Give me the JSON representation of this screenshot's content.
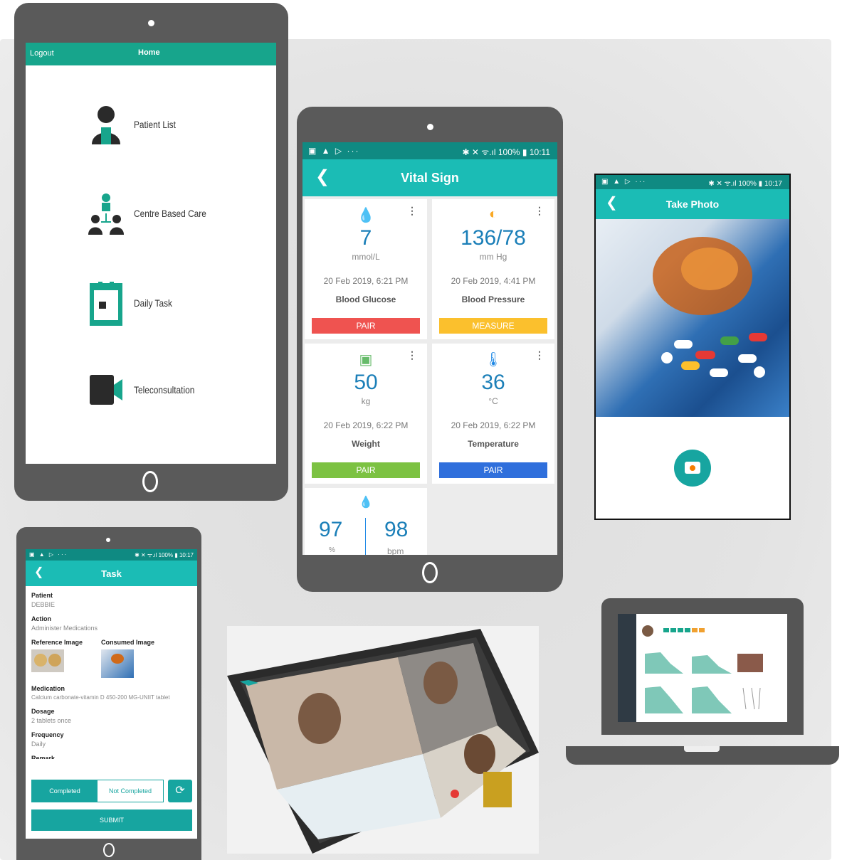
{
  "home": {
    "header": {
      "logout": "Logout",
      "title": "Home"
    },
    "items": [
      {
        "label": "Patient List",
        "icon": "patient-list-icon"
      },
      {
        "label": "Centre Based Care",
        "icon": "centre-care-icon"
      },
      {
        "label": "Daily Task",
        "icon": "daily-task-icon"
      },
      {
        "label": "Teleconsultation",
        "icon": "video-camera-icon"
      }
    ],
    "accent": "#17a58c"
  },
  "vital": {
    "status_left": "▣ ▲ ▷ ···",
    "status_right": "✱ ✕ ᯤ.ıl 100% ▮ 10:11",
    "title": "Vital Sign",
    "cards": [
      {
        "value": "7",
        "unit": "mmol/L",
        "date": "20 Feb 2019, 6:21 PM",
        "name": "Blood Glucose",
        "button": "PAIR",
        "btn_color": "#ef5350",
        "icon": "blood-drop-icon",
        "glyph": "💧",
        "icon_color": "#e53935"
      },
      {
        "value": "136/78",
        "unit": "mm Hg",
        "date": "20 Feb 2019, 4:41 PM",
        "name": "Blood Pressure",
        "button": "MEASURE",
        "btn_color": "#fbc02d",
        "icon": "bp-cuff-icon",
        "glyph": "◐",
        "icon_color": "#f9a825"
      },
      {
        "value": "50",
        "unit": "kg",
        "date": "20 Feb 2019, 6:22 PM",
        "name": "Weight",
        "button": "PAIR",
        "btn_color": "#7cc242",
        "icon": "scale-icon",
        "glyph": "▣",
        "icon_color": "#66bb6a"
      },
      {
        "value": "36",
        "unit": "°C",
        "date": "20 Feb 2019, 6:22 PM",
        "name": "Temperature",
        "button": "PAIR",
        "btn_color": "#2f6fdc",
        "icon": "thermometer-icon",
        "glyph": "🌡",
        "icon_color": "#1e88e5"
      }
    ],
    "spo2": {
      "value": "97",
      "unit": "%",
      "pulse": "98",
      "pulse_unit": "bpm"
    }
  },
  "photo": {
    "status_left": "▣ ▲ ▷ ···",
    "status_right": "✱ ✕ ᯤ.ıl 100% ▮ 10:17",
    "title": "Take Photo"
  },
  "task": {
    "status_left": "▣ ▲ ▷ ···",
    "status_right": "✱ ✕ ᯤ.ıl 100% ▮ 10:17",
    "title": "Task",
    "patient_label": "Patient",
    "patient": "DEBBIE",
    "action_label": "Action",
    "action": "Administer Medications",
    "ref_label": "Reference Image",
    "consumed_label": "Consumed Image",
    "med_label": "Medication",
    "medication": "Calcium carbonate-vitamin D 450-200 MG-UNIIT tablet",
    "dosage_label": "Dosage",
    "dosage": "2 tablets once",
    "freq_label": "Frequency",
    "frequency": "Daily",
    "remark_label": "Remark",
    "completed": "Completed",
    "not_completed": "Not Completed",
    "submit": "SUBMIT"
  }
}
